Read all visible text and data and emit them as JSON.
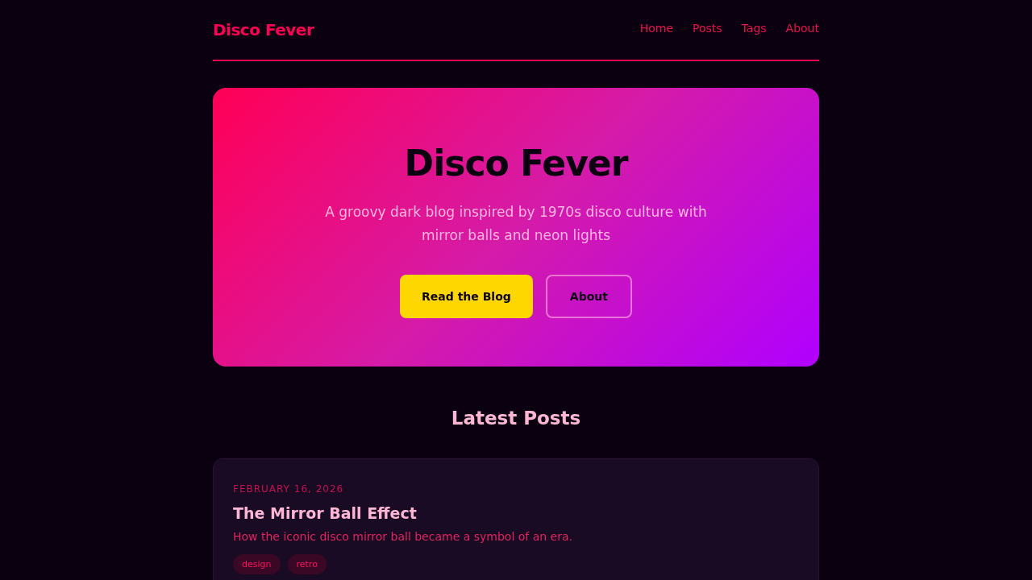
{
  "header": {
    "logo": "Disco Fever",
    "nav": [
      {
        "label": "Home"
      },
      {
        "label": "Posts"
      },
      {
        "label": "Tags"
      },
      {
        "label": "About"
      }
    ]
  },
  "hero": {
    "title": "Disco Fever",
    "subtitle": "A groovy dark blog inspired by 1970s disco culture with mirror balls and neon lights",
    "buttons": [
      {
        "label": "Read the Blog",
        "kind": "primary"
      },
      {
        "label": "About",
        "kind": "outline"
      }
    ]
  },
  "section_title": "Latest Posts",
  "posts": [
    {
      "date": "FEBRUARY 16, 2026",
      "title": "The Mirror Ball Effect",
      "excerpt": "How the iconic disco mirror ball became a symbol of an era.",
      "tags": [
        "design",
        "retro"
      ]
    }
  ]
}
